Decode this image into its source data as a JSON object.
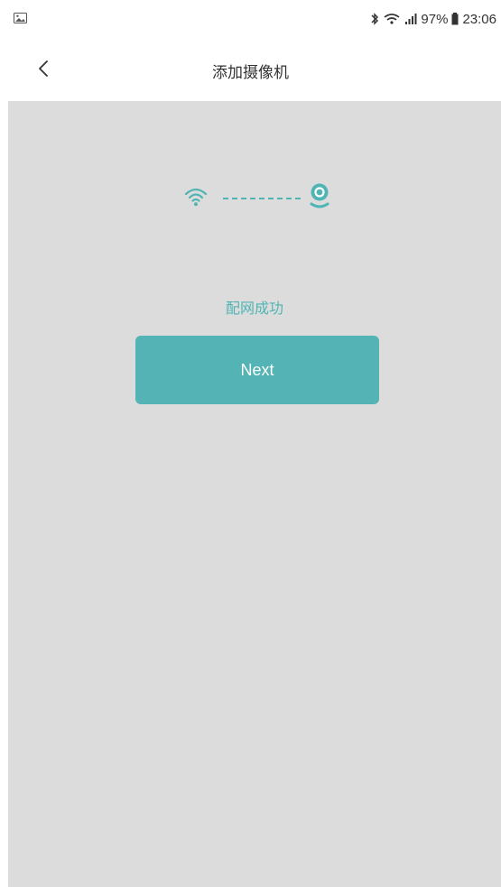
{
  "status_bar": {
    "left_icon": "image-icon",
    "icons": [
      "bluetooth-icon",
      "wifi-icon",
      "signal-icon"
    ],
    "battery_percent": "97%",
    "time": "23:06"
  },
  "header": {
    "back_icon": "chevron-left-icon",
    "title": "添加摄像机"
  },
  "main": {
    "graphic": {
      "left_icon": "wifi-icon",
      "right_icon": "camera-icon",
      "accent_color": "#4fb5b4"
    },
    "status_text": "配网成功",
    "next_button_label": "Next",
    "background_color": "#dcdcdc",
    "button_color": "#54b3b5"
  }
}
